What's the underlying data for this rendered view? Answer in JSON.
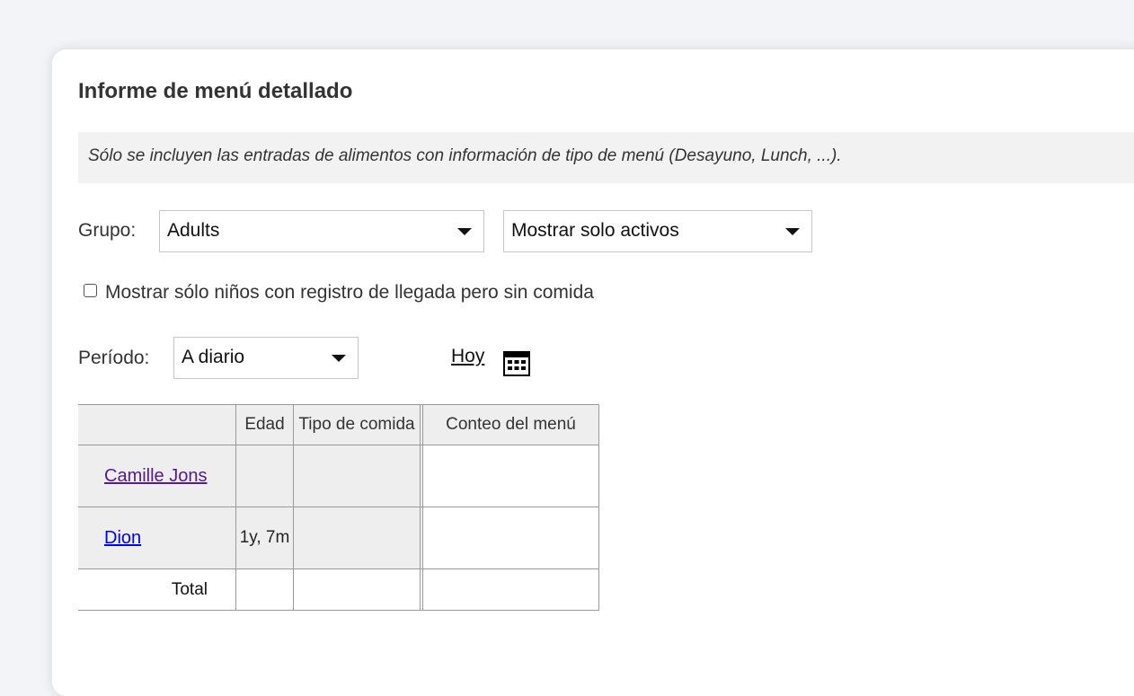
{
  "report": {
    "title": "Informe de menú detallado",
    "notice": "Sólo se incluyen las entradas de alimentos con información de tipo de menú (Desayuno, Lunch, ...)."
  },
  "filters": {
    "group_label": "Grupo:",
    "group_value": "Adults",
    "status_value": "Mostrar solo activos",
    "checkbox_label": "Mostrar sólo niños con registro de llegada pero sin comida",
    "checkbox_checked": false,
    "period_label": "Período:",
    "period_value": "A diario",
    "today_link": "Hoy",
    "calendar_icon": "calendar-icon"
  },
  "table": {
    "headers": [
      "",
      "Edad",
      "Tipo de comida",
      "Conteo del menú"
    ],
    "rows": [
      {
        "name": "Camille Jons",
        "age": "",
        "meal_type": "",
        "menu_count": ""
      },
      {
        "name": "Dion",
        "age": "1y, 7m",
        "meal_type": "",
        "menu_count": ""
      }
    ],
    "total_label": "Total"
  },
  "colors": {
    "background": "#f3f4f8",
    "visited_link": "#551a8b",
    "link": "#0000ee",
    "header_bg": "#eeeeee"
  }
}
